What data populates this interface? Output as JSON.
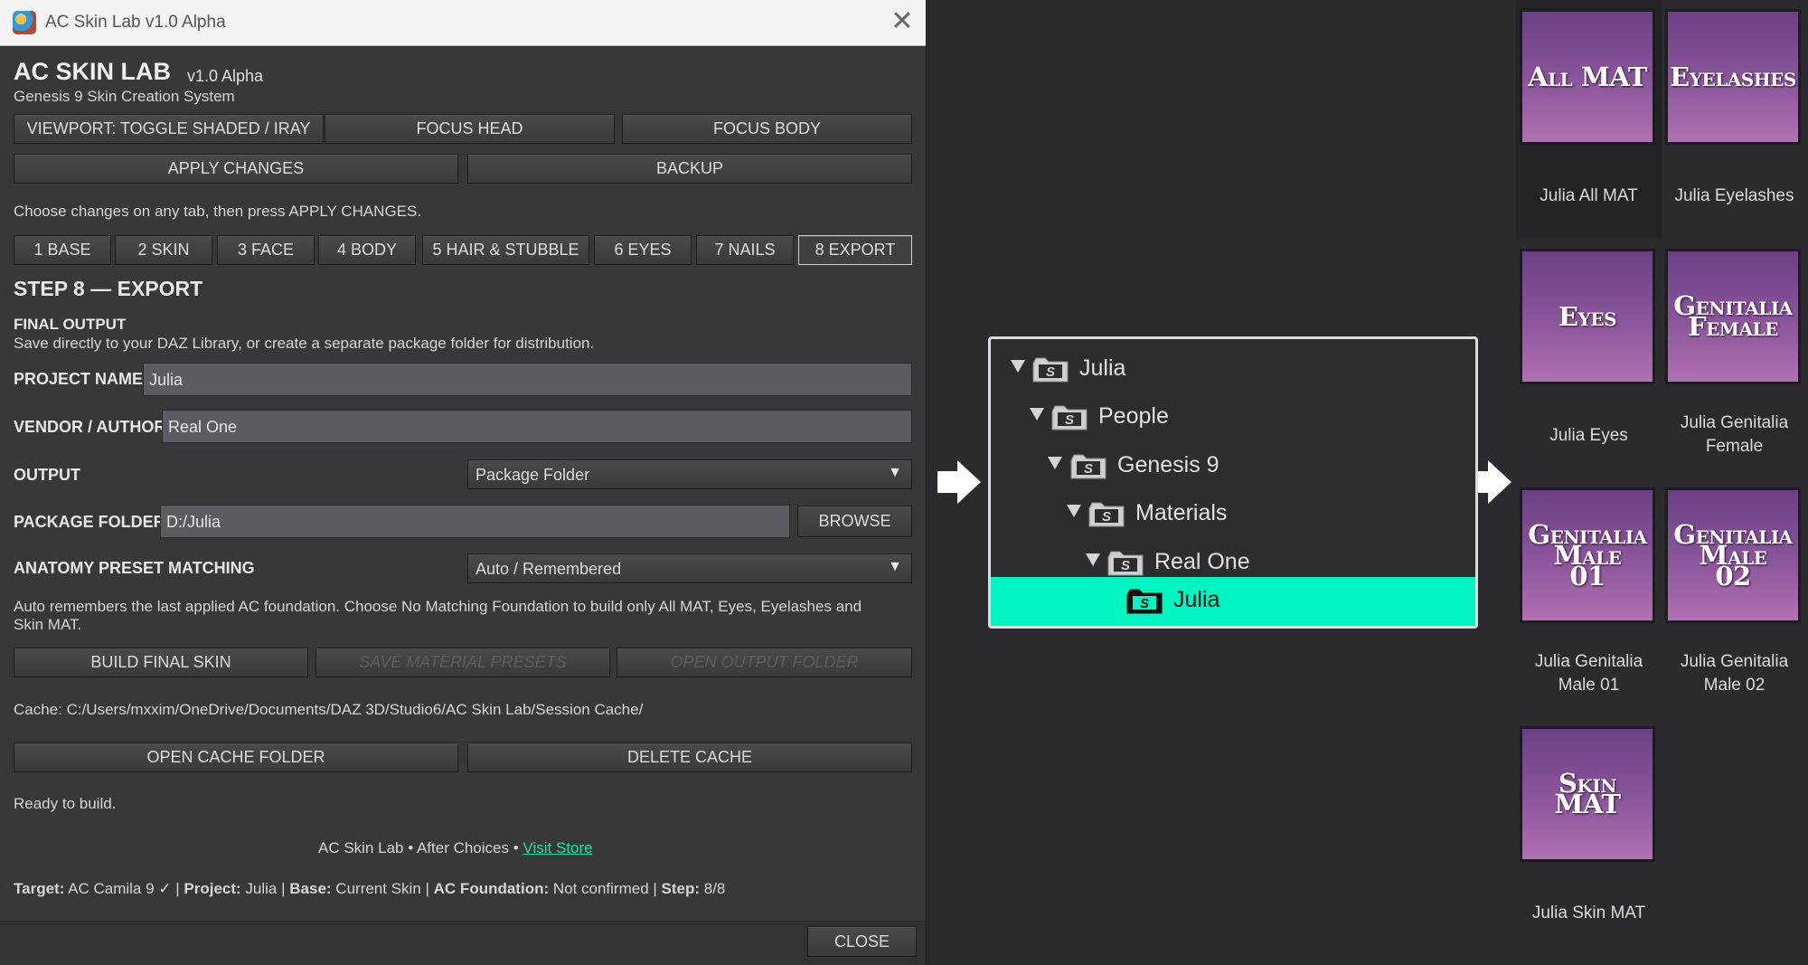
{
  "window": {
    "title": "AC Skin Lab v1.0 Alpha",
    "close_glyph": "✕"
  },
  "header": {
    "app_name": "AC SKIN LAB",
    "version": "v1.0 Alpha",
    "subtitle": "Genesis 9 Skin Creation System"
  },
  "toolbar": {
    "viewport": "VIEWPORT: TOGGLE SHADED / IRAY",
    "focus_head": "FOCUS HEAD",
    "focus_body": "FOCUS BODY",
    "apply": "APPLY CHANGES",
    "backup": "BACKUP"
  },
  "hint": "Choose changes on any tab, then press APPLY CHANGES.",
  "tabs": [
    {
      "label": "1 BASE"
    },
    {
      "label": "2 SKIN"
    },
    {
      "label": "3 FACE"
    },
    {
      "label": "4 BODY"
    },
    {
      "label": "5 HAIR & STUBBLE"
    },
    {
      "label": "6 EYES"
    },
    {
      "label": "7 NAILS"
    },
    {
      "label": "8 EXPORT",
      "active": true
    }
  ],
  "step": {
    "title": "STEP 8 — EXPORT",
    "section_title": "FINAL OUTPUT",
    "section_desc": "Save directly to your DAZ Library, or create a separate package folder for distribution."
  },
  "form": {
    "project_name_label": "PROJECT NAME",
    "project_name_value": "Julia",
    "vendor_label": "VENDOR / AUTHOR",
    "vendor_value": "Real One",
    "output_label": "OUTPUT",
    "output_value": "Package Folder",
    "package_folder_label": "PACKAGE FOLDER",
    "package_folder_value": "D:/Julia",
    "browse": "BROWSE",
    "anatomy_label": "ANATOMY PRESET MATCHING",
    "anatomy_value": "Auto / Remembered",
    "anatomy_note_1": "Auto remembers the last applied AC foundation. Choose No Matching Foundation to build only All MAT, Eyes, Eyelashes and",
    "anatomy_note_2": "Skin MAT."
  },
  "actions": {
    "build": "BUILD FINAL SKIN",
    "save_presets": "SAVE MATERIAL PRESETS",
    "open_output": "OPEN OUTPUT FOLDER",
    "open_cache": "OPEN CACHE FOLDER",
    "delete_cache": "DELETE CACHE"
  },
  "cache_path": "Cache: C:/Users/mxxim/OneDrive/Documents/DAZ 3D/Studio6/AC Skin Lab/Session Cache/",
  "status": "Ready to build.",
  "credits": {
    "text": "AC Skin Lab • After Choices • ",
    "link": "Visit Store"
  },
  "summary": {
    "target_label": "Target:",
    "target_value": " AC Camila 9 ✓ | ",
    "project_label": "Project:",
    "project_value": " Julia | ",
    "base_label": "Base:",
    "base_value": " Current Skin | ",
    "foundation_label": "AC Foundation:",
    "foundation_value": " Not confirmed | ",
    "step_label": "Step:",
    "step_value": " 8/8"
  },
  "close_button": "CLOSE",
  "tree": [
    {
      "label": "Julia"
    },
    {
      "label": "People"
    },
    {
      "label": "Genesis 9"
    },
    {
      "label": "Materials"
    },
    {
      "label": "Real One"
    },
    {
      "label": "Julia",
      "selected": true
    }
  ],
  "materials": [
    {
      "thumb_line1": "All MAT",
      "caption_line1": "Julia All MAT",
      "caption_line2": ""
    },
    {
      "thumb_line1": "Eyelashes",
      "caption_line1": "Julia Eyelashes",
      "caption_line2": ""
    },
    {
      "thumb_line1": "Eyes",
      "caption_line1": "Julia Eyes",
      "caption_line2": ""
    },
    {
      "thumb_line1": "Genitalia",
      "thumb_line2": "Female",
      "caption_line1": "Julia Genitalia",
      "caption_line2": "Female"
    },
    {
      "thumb_line1": "Genitalia",
      "thumb_line2": "Male",
      "thumb_line3": "01",
      "caption_line1": "Julia Genitalia",
      "caption_line2": "Male 01"
    },
    {
      "thumb_line1": "Genitalia",
      "thumb_line2": "Male",
      "thumb_line3": "02",
      "caption_line1": "Julia Genitalia",
      "caption_line2": "Male 02"
    },
    {
      "thumb_line1": "Skin MAT",
      "caption_line1": "Julia Skin MAT",
      "caption_line2": ""
    }
  ],
  "colors": {
    "accent": "#00f5c0",
    "link": "#20e3a2",
    "thumb_purple": "#8c569c"
  }
}
